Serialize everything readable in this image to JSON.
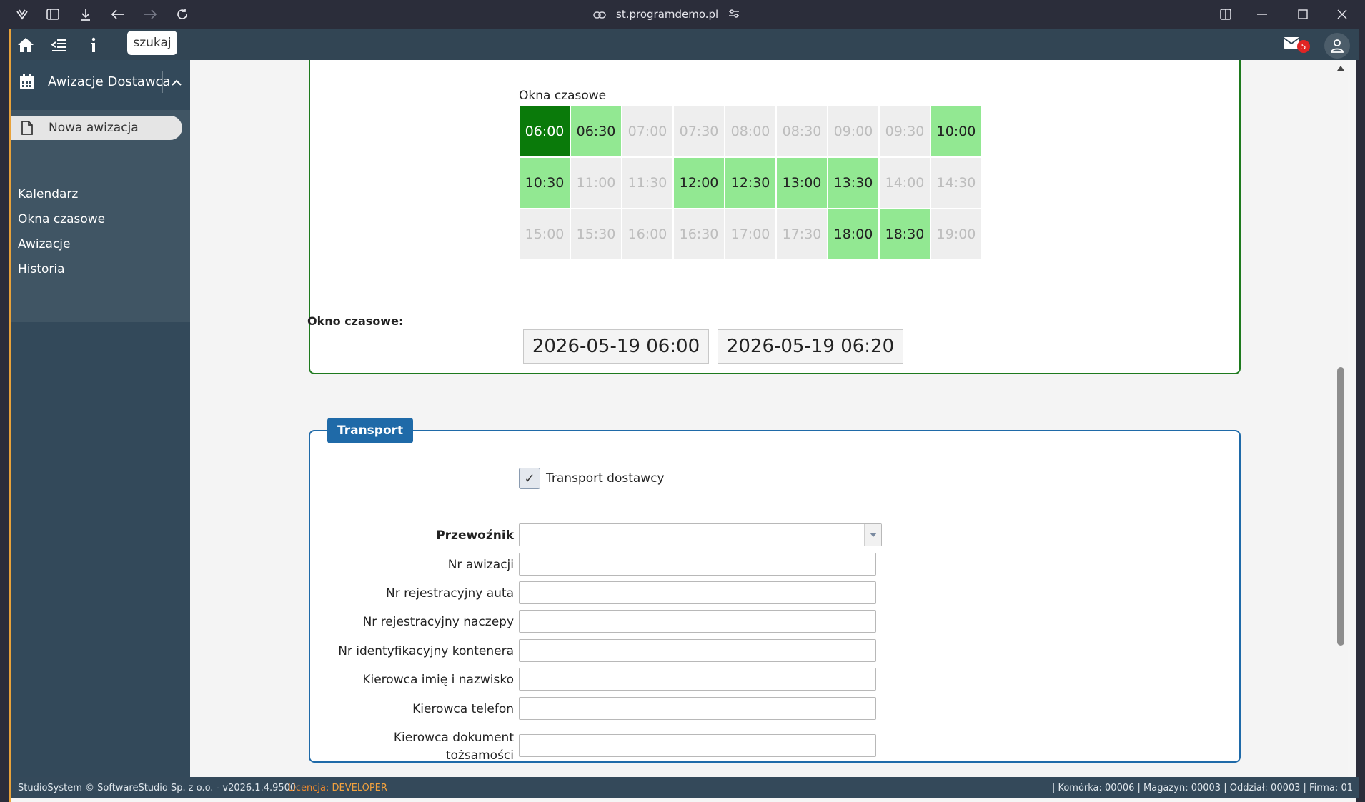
{
  "browser": {
    "url": "st.programdemo.pl",
    "icons": [
      "brand-icon",
      "sidebar-toggle-icon",
      "download-icon",
      "back-icon",
      "forward-icon",
      "reload-icon",
      "link-icon",
      "site-settings-icon",
      "split-view-icon",
      "minimize-icon",
      "maximize-icon",
      "close-icon"
    ]
  },
  "topbar": {
    "search_label": "szukaj",
    "mail_count": "5"
  },
  "sidebar": {
    "header": "Awizacje Dostawca",
    "new_item": "Nowa awizacja",
    "items": [
      {
        "label": "Kalendarz"
      },
      {
        "label": "Okna czasowe"
      },
      {
        "label": "Awizacje"
      },
      {
        "label": "Historia"
      }
    ]
  },
  "time_windows": {
    "title": "Okna czasowe",
    "slots": [
      {
        "time": "06:00",
        "state": "selected"
      },
      {
        "time": "06:30",
        "state": "available"
      },
      {
        "time": "07:00",
        "state": "unavailable"
      },
      {
        "time": "07:30",
        "state": "unavailable"
      },
      {
        "time": "08:00",
        "state": "unavailable"
      },
      {
        "time": "08:30",
        "state": "unavailable"
      },
      {
        "time": "09:00",
        "state": "unavailable"
      },
      {
        "time": "09:30",
        "state": "unavailable"
      },
      {
        "time": "10:00",
        "state": "available"
      },
      {
        "time": "10:30",
        "state": "available"
      },
      {
        "time": "11:00",
        "state": "unavailable"
      },
      {
        "time": "11:30",
        "state": "unavailable"
      },
      {
        "time": "12:00",
        "state": "available"
      },
      {
        "time": "12:30",
        "state": "available"
      },
      {
        "time": "13:00",
        "state": "available"
      },
      {
        "time": "13:30",
        "state": "available"
      },
      {
        "time": "14:00",
        "state": "unavailable"
      },
      {
        "time": "14:30",
        "state": "unavailable"
      },
      {
        "time": "15:00",
        "state": "unavailable"
      },
      {
        "time": "15:30",
        "state": "unavailable"
      },
      {
        "time": "16:00",
        "state": "unavailable"
      },
      {
        "time": "16:30",
        "state": "unavailable"
      },
      {
        "time": "17:00",
        "state": "unavailable"
      },
      {
        "time": "17:30",
        "state": "unavailable"
      },
      {
        "time": "18:00",
        "state": "available"
      },
      {
        "time": "18:30",
        "state": "available"
      },
      {
        "time": "19:00",
        "state": "unavailable"
      }
    ],
    "window_label": "Okno czasowe:",
    "window_start": "2026-05-19 06:00",
    "window_end": "2026-05-19 06:20"
  },
  "transport": {
    "legend": "Transport",
    "checkbox_label": "Transport dostawcy",
    "checkbox_checked": true,
    "checkbox_mark": "✓",
    "carrier_label": "Przewoźnik",
    "carrier_value": "",
    "fields": [
      {
        "label": "Nr awizacji",
        "value": ""
      },
      {
        "label": "Nr rejestracyjny auta",
        "value": ""
      },
      {
        "label": "Nr rejestracyjny naczepy",
        "value": ""
      },
      {
        "label": "Nr identyfikacyjny kontenera",
        "value": ""
      },
      {
        "label": "Kierowca imię i nazwisko",
        "value": ""
      },
      {
        "label": "Kierowca telefon",
        "value": ""
      }
    ],
    "doc_label_line1": "Kierowca dokument",
    "doc_label_line2": "tożsamości",
    "doc_value": ""
  },
  "footer": {
    "copyright": "StudioSystem © SoftwareStudio Sp. z o.o. - v2026.1.4.9500",
    "license_prefix": "Licencja:",
    "license_value": "DEVELOPER",
    "status": "| Komórka: 00006 | Magazyn: 00003 | Oddział: 00003 | Firma: 01"
  },
  "colors": {
    "selected": "#0a7a0a",
    "available": "#92e892",
    "unavailable": "#eeeeee",
    "sidebar": "#33495a",
    "accent_blue": "#1f6aa8"
  }
}
